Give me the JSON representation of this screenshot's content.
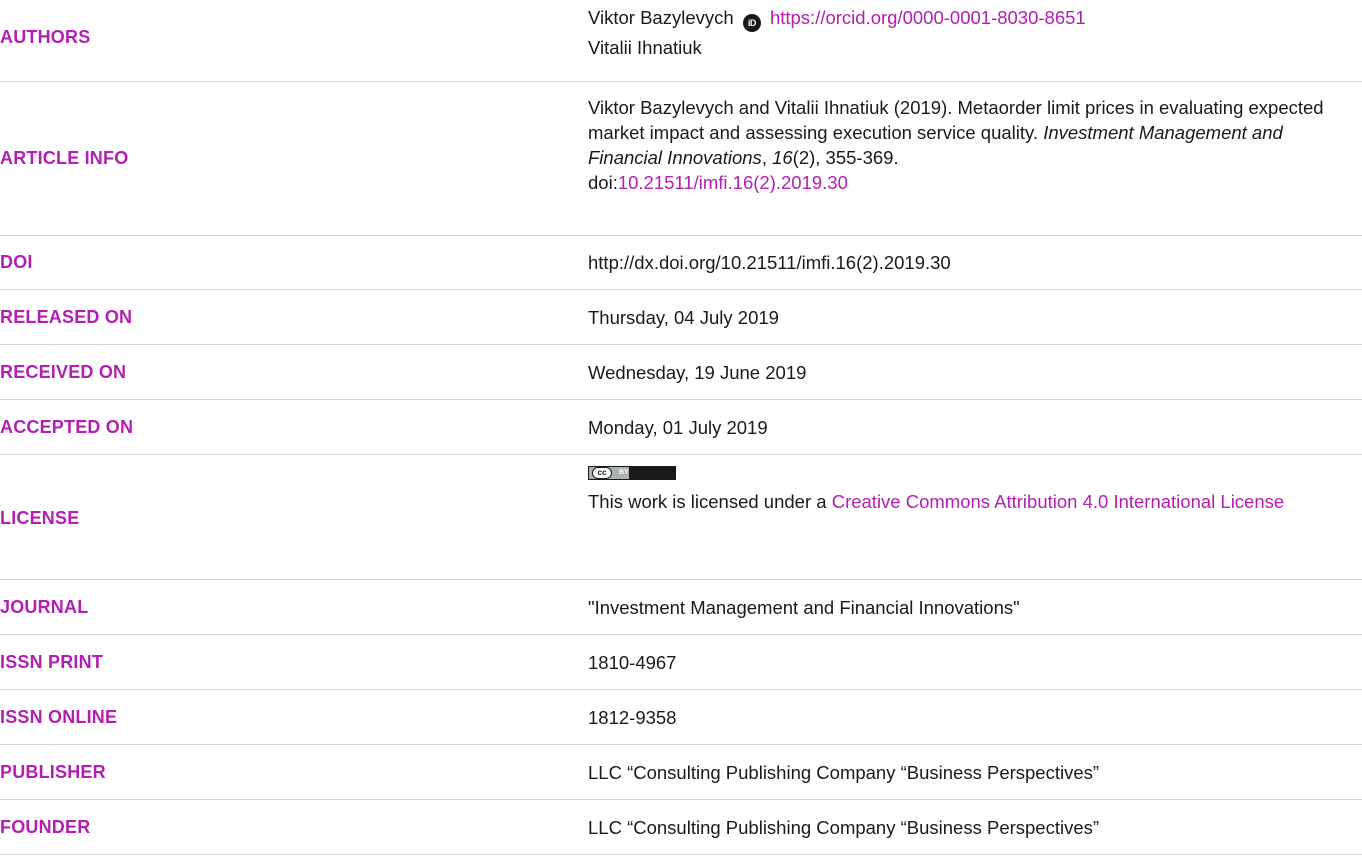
{
  "authors": {
    "label": "AUTHORS",
    "author1": "Viktor Bazylevych",
    "orcid_icon_text": "iD",
    "orcid_url": "https://orcid.org/0000-0001-8030-8651",
    "author2": "Vitalii Ihnatiuk"
  },
  "article_info": {
    "label": "ARTICLE INFO",
    "citation_prefix": "Viktor Bazylevych and Vitalii Ihnatiuk (2019). Metaorder limit prices in evaluating expected market impact and assessing execution service quality. ",
    "journal_italic": "Investment Management and Financial Innovations",
    "sep1": ", ",
    "volume_italic": "16",
    "issue_pages": "(2), 355-369.",
    "doi_prefix": "doi:",
    "doi_link": "10.21511/imfi.16(2).2019.30"
  },
  "doi": {
    "label": "DOI",
    "value": "http://dx.doi.org/10.21511/imfi.16(2).2019.30"
  },
  "released_on": {
    "label": "RELEASED ON",
    "value": "Thursday, 04 July 2019"
  },
  "received_on": {
    "label": "RECEIVED ON",
    "value": "Wednesday, 19 June 2019"
  },
  "accepted_on": {
    "label": "ACCEPTED ON",
    "value": "Monday, 01 July 2019"
  },
  "license": {
    "label": "LICENSE",
    "badge_cc": "cc",
    "badge_by": "BY",
    "text_prefix": "This work is licensed under a ",
    "link_text": "Creative Commons Attribution 4.0 International License"
  },
  "journal": {
    "label": "JOURNAL",
    "value": "\"Investment Management and Financial Innovations\""
  },
  "issn_print": {
    "label": "ISSN PRINT",
    "value": "1810-4967"
  },
  "issn_online": {
    "label": "ISSN ONLINE",
    "value": "1812-9358"
  },
  "publisher": {
    "label": "PUBLISHER",
    "value": "LLC “Consulting Publishing Company “Business Perspectives”"
  },
  "founder": {
    "label": "FOUNDER",
    "value": "LLC “Consulting Publishing Company “Business Perspectives”"
  },
  "colors": {
    "accent": "#b31eb3",
    "text": "#1a1a1a",
    "divider": "#d6d6d6"
  }
}
